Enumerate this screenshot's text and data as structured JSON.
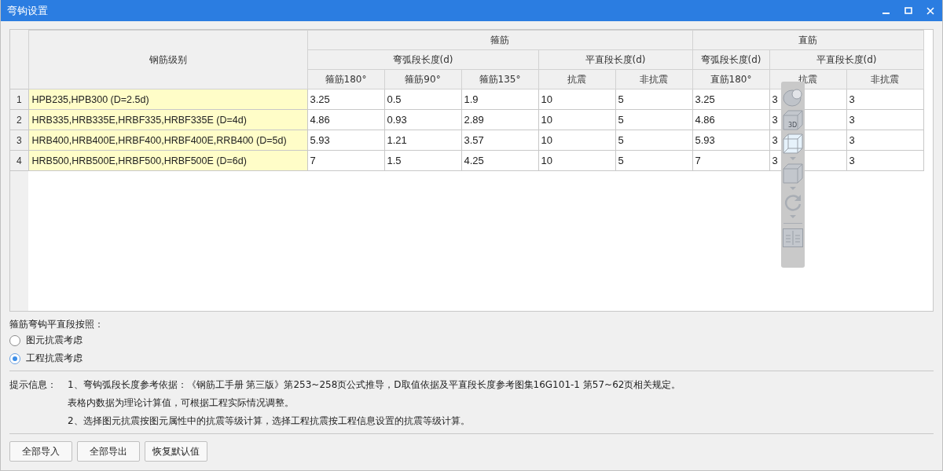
{
  "window": {
    "title": "弯钩设置"
  },
  "table": {
    "grade_header": "钢筋级别",
    "groups": [
      {
        "label": "箍筋",
        "subgroups": [
          {
            "label": "弯弧段长度(d)",
            "columns": [
              "箍筋180°",
              "箍筋90°",
              "箍筋135°"
            ]
          },
          {
            "label": "平直段长度(d)",
            "columns": [
              "抗震",
              "非抗震"
            ]
          }
        ]
      },
      {
        "label": "直筋",
        "subgroups": [
          {
            "label": "弯弧段长度(d)",
            "columns": [
              "直筋180°"
            ]
          },
          {
            "label": "平直段长度(d)",
            "columns": [
              "抗震",
              "非抗震"
            ]
          }
        ]
      }
    ],
    "rows": [
      {
        "number": "1",
        "grade": "HPB235,HPB300 (D=2.5d)",
        "values": [
          "3.25",
          "0.5",
          "1.9",
          "10",
          "5",
          "3.25",
          "3",
          "3"
        ]
      },
      {
        "number": "2",
        "grade": "HRB335,HRB335E,HRBF335,HRBF335E (D=4d)",
        "values": [
          "4.86",
          "0.93",
          "2.89",
          "10",
          "5",
          "4.86",
          "3",
          "3"
        ]
      },
      {
        "number": "3",
        "grade": "HRB400,HRB400E,HRBF400,HRBF400E,RRB400 (D=5d)",
        "values": [
          "5.93",
          "1.21",
          "3.57",
          "10",
          "5",
          "5.93",
          "3",
          "3"
        ]
      },
      {
        "number": "4",
        "grade": "HRB500,HRB500E,HRBF500,HRBF500E (D=6d)",
        "values": [
          "7",
          "1.5",
          "4.25",
          "10",
          "5",
          "7",
          "3",
          "3"
        ]
      }
    ]
  },
  "toolbar": {
    "items": [
      {
        "kind": "sphere",
        "caret": false
      },
      {
        "kind": "cube3d",
        "label": "3D",
        "caret": false
      },
      {
        "kind": "glasscube",
        "caret": true
      },
      {
        "kind": "cube",
        "caret": true
      },
      {
        "kind": "rotate",
        "caret": true
      },
      {
        "kind": "divider"
      },
      {
        "kind": "checklist",
        "caret": false
      }
    ]
  },
  "hook_mode": {
    "label": "箍筋弯钩平直段按照：",
    "options": [
      {
        "label": "图元抗震考虑",
        "selected": false
      },
      {
        "label": "工程抗震考虑",
        "selected": true
      }
    ]
  },
  "hints": {
    "label": "提示信息：",
    "lines": [
      "1、弯钩弧段长度参考依据：《钢筋工手册 第三版》第253~258页公式推导，D取值依据及平直段长度参考图集16G101-1 第57~62页相关规定。",
      "表格内数据为理论计算值，可根据工程实际情况调整。",
      "2、选择图元抗震按图元属性中的抗震等级计算，选择工程抗震按工程信息设置的抗震等级计算。"
    ]
  },
  "buttons": [
    "全部导入",
    "全部导出",
    "恢复默认值"
  ]
}
